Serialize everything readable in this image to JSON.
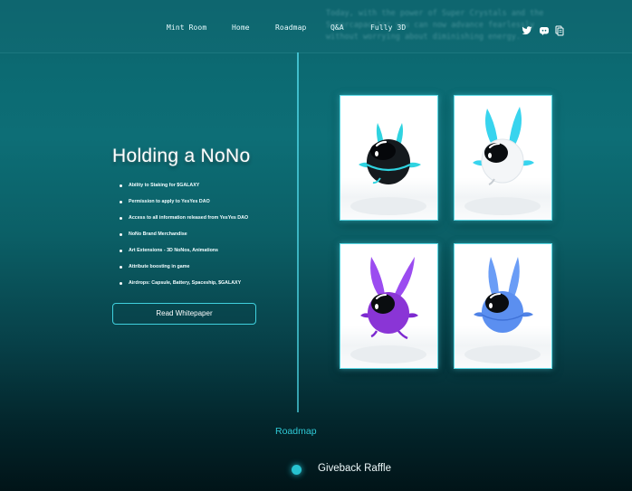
{
  "nav": {
    "ghost_text": "Today, with the power of Super Crystals and the Supercapacitor you can now advance fearlessly without worrying about diminishing energy.",
    "links": [
      "Mint Room",
      "Home",
      "Roadmap",
      "Q&A",
      "Fully 3D"
    ],
    "icons": [
      "twitter-icon",
      "discord-icon",
      "document-icon"
    ]
  },
  "holding": {
    "title": "Holding a NoNo",
    "benefits": [
      "Ability to Staking for $GALAXY",
      "Permission to apply to YesYes DAO",
      "Access to all information released from YesYes DAO",
      "NoNo Brand Merchandise",
      "Art Extensions - 3D NoNos, Animations",
      "Attribute boosting in game",
      "Airdrops: Capsule, Battery, Spaceship, $GALAXY"
    ],
    "button_label": "Read Whitepaper"
  },
  "nfts": [
    {
      "name": "black-nono",
      "body_color": "#151a1e",
      "accent_color": "#2fd3e0"
    },
    {
      "name": "white-nono",
      "body_color": "#f4f6f8",
      "accent_color": "#38d4ee"
    },
    {
      "name": "purple-nono",
      "body_color": "#8a35d6",
      "accent_color": "#9b4cf0"
    },
    {
      "name": "blue-nono",
      "body_color": "#5b8ff0",
      "accent_color": "#6a9df6"
    }
  ],
  "roadmap": {
    "heading": "Roadmap",
    "first_item": "Giveback Raffle"
  },
  "colors": {
    "accent": "#2fc9d6",
    "background_top": "#0b6068",
    "background_bottom": "#011418"
  }
}
